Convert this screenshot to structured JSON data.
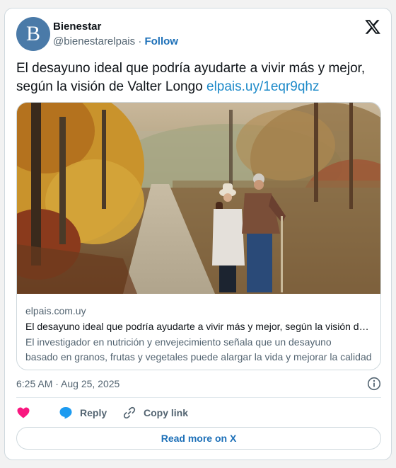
{
  "author": {
    "avatar_letter": "B",
    "avatar_color": "#4a7aa8",
    "name": "Bienestar",
    "handle": "@bienestarelpais",
    "separator": "·",
    "follow_label": "Follow"
  },
  "tweet": {
    "text": "El desayuno ideal que podría ayudarte a vivir más y mejor, según la visión de Valter Longo",
    "link": "elpais.uy/1eqr9qhz"
  },
  "link_card": {
    "image_icon": "autumn-forest-path-photo",
    "domain": "elpais.com.uy",
    "title": "El desayuno ideal que podría ayudarte a vivir más y mejor, según la visión de Valter Longo",
    "description_line1": "El investigador en nutrición y envejecimiento señala que un desayuno",
    "description_line2": "basado en granos, frutas y vegetales puede alargar la vida y mejorar la calidad"
  },
  "timestamp": "6:25 AM · Aug 25, 2025",
  "actions": {
    "like_icon": "heart-icon",
    "like_color": "#f91880",
    "reply_icon": "reply-bubble-icon",
    "reply_label": "Reply",
    "copy_icon": "link-icon",
    "copy_label": "Copy link"
  },
  "read_more_label": "Read more on X",
  "colors": {
    "link": "#1d8ac9",
    "accent": "#1d70b8",
    "muted": "#536471",
    "border": "#cfd9de"
  }
}
